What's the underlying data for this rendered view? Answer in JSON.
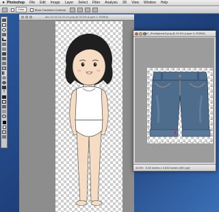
{
  "menubar": {
    "apple_icon": "apple-icon",
    "items": [
      "Photoshop",
      "File",
      "Edit",
      "Image",
      "Layer",
      "Select",
      "Filter",
      "Analysis",
      "3D",
      "View",
      "Window",
      "Help"
    ]
  },
  "options_bar": {
    "color_label": "Color",
    "transform_label": "Show Transform Controls"
  },
  "document_back": {
    "title": "abc-01-01-01-01-01.png @ 33.3% (Layer 1, RGB/8)"
  },
  "document_front": {
    "title": "DAC_Shortsjeans3.png @ 43.6% (Layer 0, RGB/8)",
    "zoom": "43.6%",
    "status_info": "5.63 inches x 4.833 inches (300 ppi)"
  },
  "colors": {
    "desktop": "#2c5aa0",
    "skin": "#f6dcc2",
    "hair": "#1f1f1f",
    "denim": "#4e6d8d"
  }
}
